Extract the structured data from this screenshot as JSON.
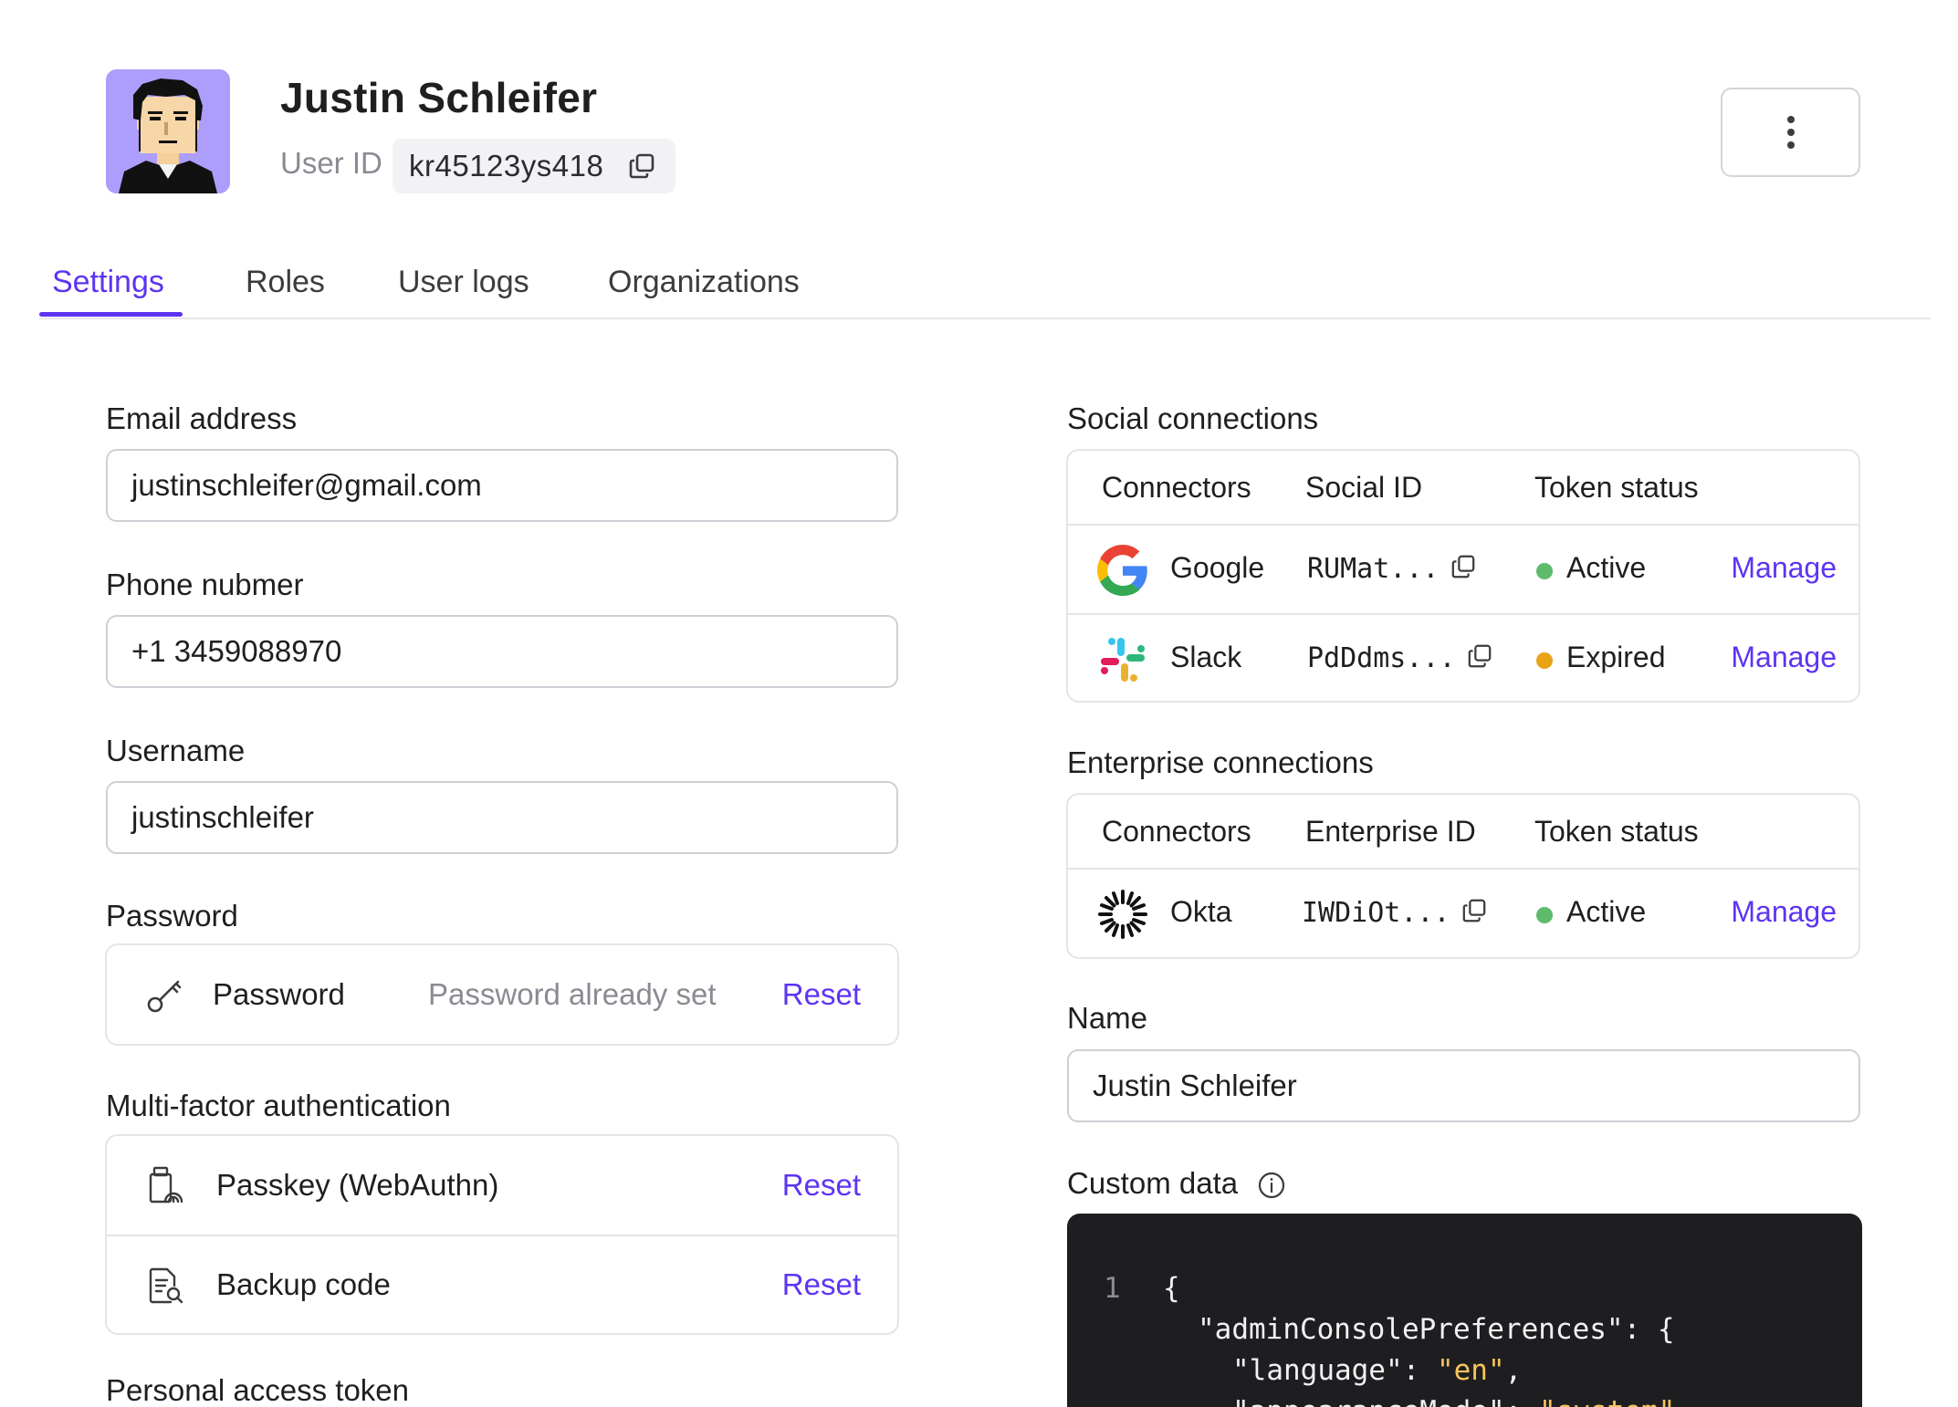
{
  "user": {
    "name": "Justin Schleifer",
    "id_label": "User ID",
    "id_value": "kr45123ys418"
  },
  "tabs": [
    {
      "label": "Settings",
      "active": true
    },
    {
      "label": "Roles",
      "active": false
    },
    {
      "label": "User logs",
      "active": false
    },
    {
      "label": "Organizations",
      "active": false
    }
  ],
  "fields": {
    "email_label": "Email address",
    "email_value": "justinschleifer@gmail.com",
    "phone_label": "Phone nubmer",
    "phone_value": "+1 3459088970",
    "username_label": "Username",
    "username_value": "justinschleifer"
  },
  "password": {
    "section_label": "Password",
    "row_title": "Password",
    "row_status": "Password already set",
    "reset_label": "Reset"
  },
  "mfa": {
    "section_label": "Multi-factor authentication",
    "items": [
      {
        "label": "Passkey (WebAuthn)",
        "action": "Reset"
      },
      {
        "label": "Backup code",
        "action": "Reset"
      }
    ]
  },
  "pat": {
    "section_label": "Personal access token"
  },
  "social": {
    "section_label": "Social connections",
    "headers": [
      "Connectors",
      "Social ID",
      "Token status"
    ],
    "rows": [
      {
        "connector": "Google",
        "id": "RUMat...",
        "status": "Active",
        "status_color": "#5fbb6c",
        "action": "Manage"
      },
      {
        "connector": "Slack",
        "id": "PdDdms...",
        "status": "Expired",
        "status_color": "#e8a317",
        "action": "Manage"
      }
    ]
  },
  "enterprise": {
    "section_label": "Enterprise connections",
    "headers": [
      "Connectors",
      "Enterprise ID",
      "Token status"
    ],
    "rows": [
      {
        "connector": "Okta",
        "id": "IWDiOt...",
        "status": "Active",
        "status_color": "#5fbb6c",
        "action": "Manage"
      }
    ]
  },
  "profile": {
    "name_label": "Name",
    "name_value": "Justin Schleifer",
    "custom_data_label": "Custom data"
  },
  "code": {
    "line_number": "1",
    "line1": "{",
    "line2_key": "\"adminConsolePreferences\": {",
    "line3_key": "\"language\": ",
    "line3_val": "\"en\"",
    "line3_end": ",",
    "line4_key": "\"appearanceMode\": ",
    "line4_val": "\"system\""
  },
  "colors": {
    "accent": "#5d34f2",
    "active": "#5fbb6c",
    "expired": "#e8a317",
    "avatar_bg": "#ad9dfc"
  },
  "icons": [
    "copy-icon",
    "more-vertical-icon",
    "key-icon",
    "passkey-icon",
    "backup-code-icon",
    "google-logo-icon",
    "slack-logo-icon",
    "okta-logo-icon",
    "info-icon"
  ]
}
